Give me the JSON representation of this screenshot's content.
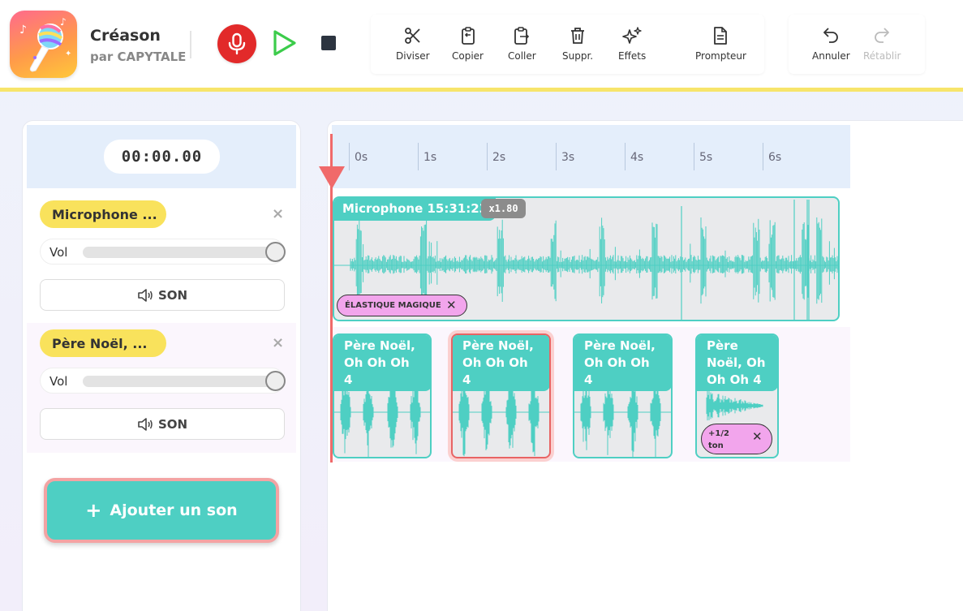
{
  "app": {
    "title": "Créason",
    "subtitle": "par CAPYTALE"
  },
  "colors": {
    "accent_teal": "#4ecfc3",
    "record_red": "#e22a2a",
    "track_label_yellow": "#f9e25c",
    "effect_pink": "#f2a5ec",
    "playhead_red": "#f06a6a",
    "header_border_yellow": "#f7e56b"
  },
  "transport": {
    "record_icon": "microphone-icon",
    "play_icon": "play-icon",
    "stop_icon": "stop-icon"
  },
  "toolbar": {
    "diviser": "Diviser",
    "copier": "Copier",
    "coller": "Coller",
    "suppr": "Suppr.",
    "effets": "Effets",
    "prompteur": "Prompteur",
    "annuler": "Annuler",
    "retablir": "Rétablir"
  },
  "timer": "00:00.00",
  "tracks": [
    {
      "name": "Microphone ...",
      "vol_label": "Vol",
      "volume": 1.0,
      "son_label": "SON",
      "close": "×"
    },
    {
      "name": "Père Noël, ...",
      "vol_label": "Vol",
      "volume": 1.0,
      "son_label": "SON",
      "close": "×"
    }
  ],
  "add_button": {
    "plus": "+",
    "label": "Ajouter un son"
  },
  "ruler": {
    "ticks": [
      "0s",
      "1s",
      "2s",
      "3s",
      "4s",
      "5s",
      "6s"
    ]
  },
  "clips": {
    "microphone": {
      "label": "Microphone 15:31:23",
      "speed": "x1.80",
      "effect": "ÉLASTIQUE MAGIQUE",
      "effect_close": "✕"
    },
    "pere_noel": [
      {
        "line1": "Père Noël,",
        "line2": "Oh Oh Oh 4",
        "selected": false
      },
      {
        "line1": "Père Noël,",
        "line2": "Oh Oh Oh 4",
        "selected": true
      },
      {
        "line1": "Père Noël,",
        "line2": "Oh Oh Oh 4",
        "selected": false
      },
      {
        "line1": "Père",
        "line2": "Noël, Oh",
        "line3": "Oh Oh 4",
        "effect_line1": "+1/2",
        "effect_line2": "ton",
        "effect_close": "✕",
        "selected": false
      }
    ]
  }
}
